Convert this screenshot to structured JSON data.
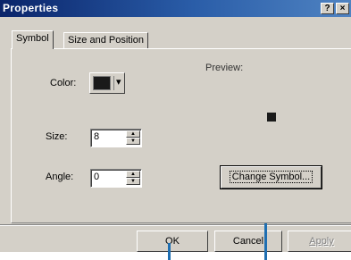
{
  "window": {
    "title": "Properties",
    "help_glyph": "?",
    "close_glyph": "×"
  },
  "tabs": [
    {
      "label": "Symbol",
      "active": true
    },
    {
      "label": "Size and Position",
      "active": false
    }
  ],
  "symbol_tab": {
    "color_label": "Color:",
    "color_value": "#1a1a1a",
    "dropdown_glyph": "▾",
    "size_label": "Size:",
    "size_value": "8",
    "angle_label": "Angle:",
    "angle_value": "0",
    "preview_label": "Preview:",
    "preview_color": "#1a1a1a",
    "change_symbol_label": "Change Symbol..."
  },
  "footer": {
    "ok_label": "OK",
    "cancel_label": "Cancel",
    "apply_label": "Apply",
    "apply_enabled": false
  },
  "callout_color": "#1f6fb2"
}
